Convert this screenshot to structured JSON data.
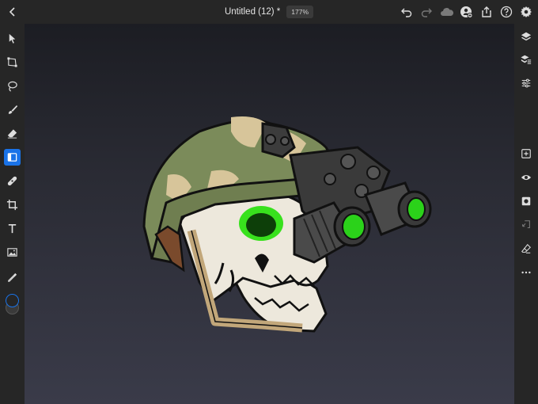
{
  "app": {
    "document_title": "Untitled (12) *",
    "zoom_level": "177%"
  },
  "top_toolbar": {
    "icons": [
      "back-chevron-icon",
      "undo-icon",
      "redo-icon",
      "cloud-icon",
      "invite-user-icon",
      "share-icon",
      "help-icon",
      "settings-gear-icon"
    ]
  },
  "left_toolbar": {
    "tools": [
      "select",
      "transform",
      "lasso",
      "brush",
      "eraser",
      "fill",
      "healing",
      "crop",
      "type",
      "image",
      "eyedropper"
    ],
    "active_tool": "fill",
    "primary_color": "#1a73e8",
    "secondary_color": "#3a3a3a"
  },
  "right_toolbar": {
    "icons": [
      "layers-icon",
      "layer-properties-icon",
      "adjustments-icon",
      "add-layer-icon",
      "visibility-icon",
      "mask-icon",
      "import-icon",
      "clear-icon",
      "more-icon"
    ]
  },
  "colors": {
    "accent": "#1a73e8",
    "toolbar_bg": "#262626",
    "helmet_green": "#7b8b5a",
    "helmet_tan": "#d7c59a",
    "lens_green": "#2bd21a",
    "skull": "#ede8dc"
  }
}
